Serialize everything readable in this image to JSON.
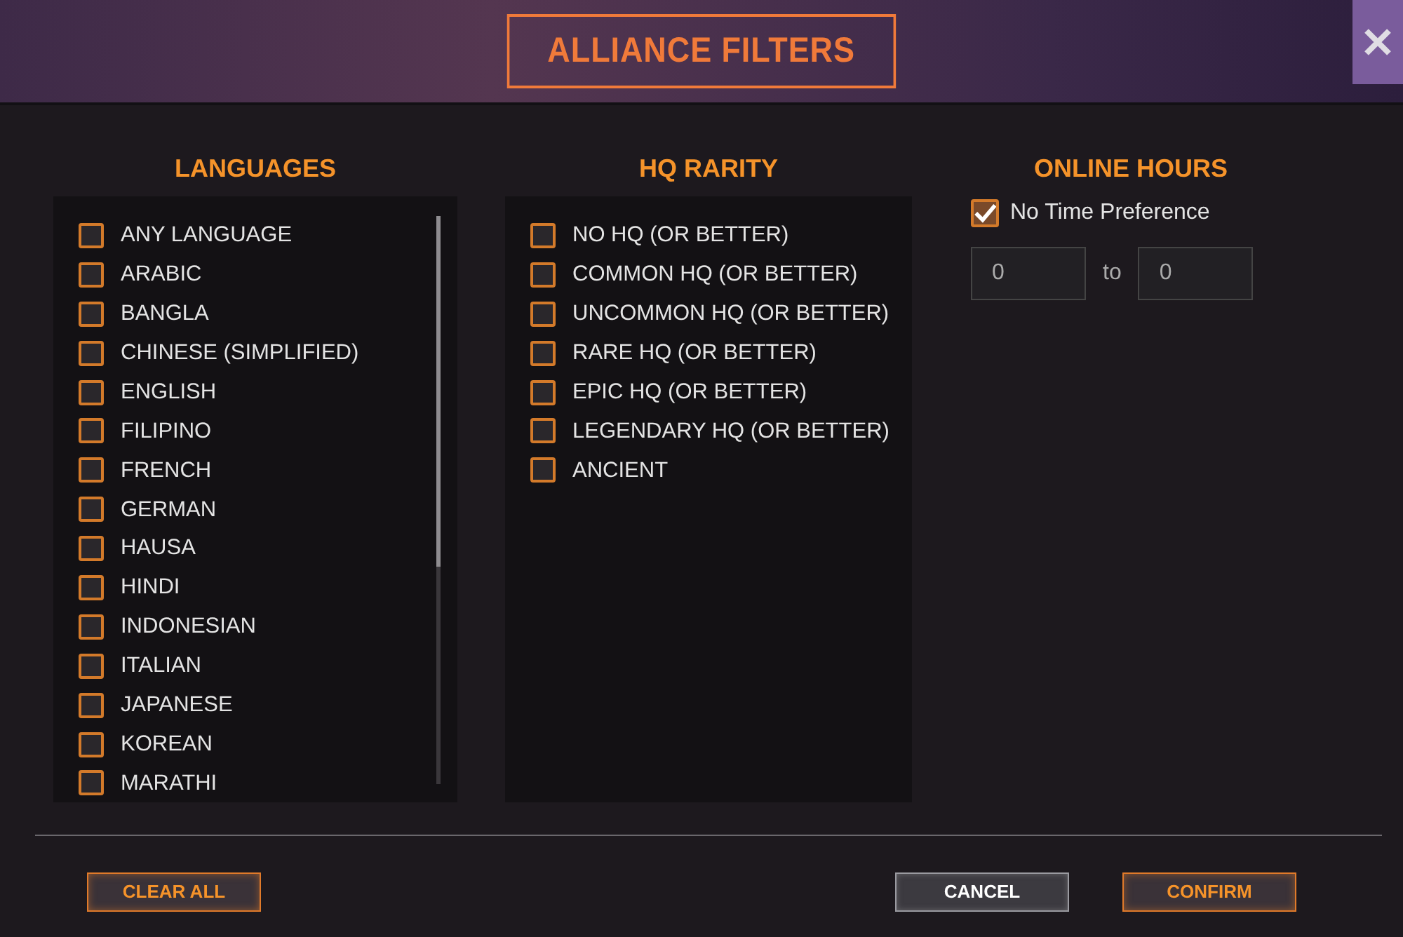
{
  "window": {
    "title": "ALLIANCE FILTERS"
  },
  "languages": {
    "heading": "LANGUAGES",
    "items": [
      {
        "label": "ANY LANGUAGE",
        "checked": false
      },
      {
        "label": "ARABIC",
        "checked": false
      },
      {
        "label": "BANGLA",
        "checked": false
      },
      {
        "label": "CHINESE (SIMPLIFIED)",
        "checked": false
      },
      {
        "label": "ENGLISH",
        "checked": false
      },
      {
        "label": "FILIPINO",
        "checked": false
      },
      {
        "label": "FRENCH",
        "checked": false
      },
      {
        "label": "GERMAN",
        "checked": false
      },
      {
        "label": "HAUSA",
        "checked": false
      },
      {
        "label": "HINDI",
        "checked": false
      },
      {
        "label": "INDONESIAN",
        "checked": false
      },
      {
        "label": "ITALIAN",
        "checked": false
      },
      {
        "label": "JAPANESE",
        "checked": false
      },
      {
        "label": "KOREAN",
        "checked": false
      },
      {
        "label": "MARATHI",
        "checked": false
      }
    ]
  },
  "hq_rarity": {
    "heading": "HQ RARITY",
    "items": [
      {
        "label": "NO HQ (OR BETTER)",
        "checked": false
      },
      {
        "label": "COMMON HQ (OR BETTER)",
        "checked": false
      },
      {
        "label": "UNCOMMON HQ (OR BETTER)",
        "checked": false
      },
      {
        "label": "RARE HQ (OR BETTER)",
        "checked": false
      },
      {
        "label": "EPIC HQ (OR BETTER)",
        "checked": false
      },
      {
        "label": "LEGENDARY HQ (OR BETTER)",
        "checked": false
      },
      {
        "label": "ANCIENT",
        "checked": false
      }
    ]
  },
  "online_hours": {
    "heading": "ONLINE HOURS",
    "no_time_preference": {
      "label": "No Time Preference",
      "checked": true
    },
    "from": "0",
    "separator": "to",
    "until": "0"
  },
  "buttons": [
    {
      "label": "CLEAR ALL",
      "kind": "accent"
    },
    {
      "label": "CANCEL",
      "kind": "neutral"
    },
    {
      "label": "CONFIRM",
      "kind": "accent"
    }
  ]
}
